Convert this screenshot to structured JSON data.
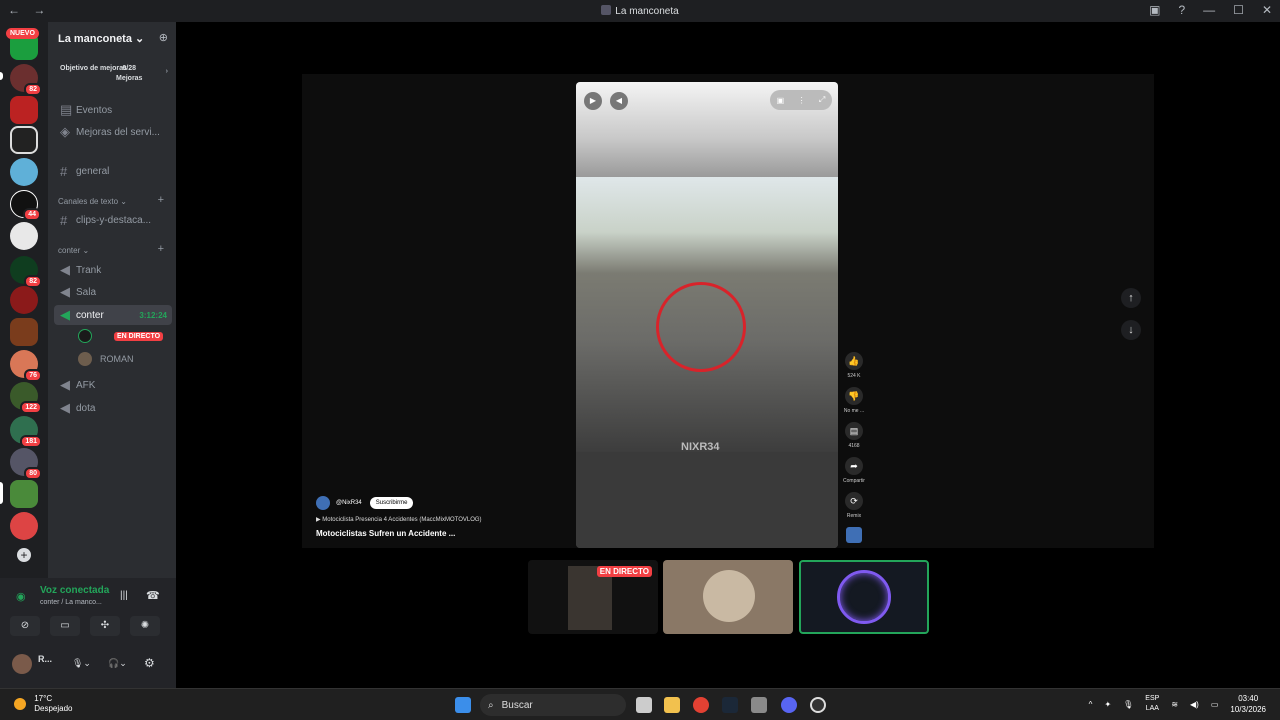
{
  "window": {
    "title": "La manconeta",
    "back": "←",
    "forward": "→",
    "min": "—",
    "max": "☐",
    "close": "✕"
  },
  "guilds": {
    "nuevo": "NUEVO",
    "badges": [
      "82",
      "44",
      "82",
      "76",
      "122",
      "181",
      "80"
    ]
  },
  "server": {
    "name": "La manconeta",
    "chevron": "⌄",
    "add_user_icon": "person-add-icon"
  },
  "boost": {
    "goal_label": "Objetivo de mejoras",
    "count": "0/28",
    "unit": "Mejoras",
    "arrow": "›"
  },
  "channels": {
    "events": "Eventos",
    "server_boosts": "Mejoras del servi...",
    "general": "general",
    "text_category": "Canales de texto",
    "clips": "clips-y-destaca...",
    "voice_category": "conter",
    "trank": "Trank",
    "sala": "Sala",
    "conter": "conter",
    "conter_time": "3:12:24",
    "live_label": "EN DIRECTO",
    "roman": "ROMAN",
    "afk": "AFK",
    "dota": "dota"
  },
  "voice": {
    "status": "Voz conectada",
    "location": "conter / La manco...",
    "user": "R..."
  },
  "video": {
    "watermark": "NIXR34",
    "channel": "@NixR34",
    "subscribe": "Suscribirme",
    "song": "Motociclista Presencia 4 Accidentes (MaccMixMOTOVLOG)",
    "title": "Motociclistas Sufren un Accidente ...",
    "likes": "524 K",
    "dislike": "No me ...",
    "comments": "4168",
    "share": "Compartir",
    "remix": "Remix"
  },
  "thumbs": {
    "live_label": "EN DIRECTO"
  },
  "taskbar": {
    "temp": "17°C",
    "weather": "Despejado",
    "search": "Buscar",
    "lang1": "ESP",
    "lang2": "LAA",
    "time": "03:40",
    "date": "10/3/2026"
  },
  "colors": {
    "green": "#23a55a",
    "red": "#f23f43",
    "sidebar": "#2b2d31"
  }
}
